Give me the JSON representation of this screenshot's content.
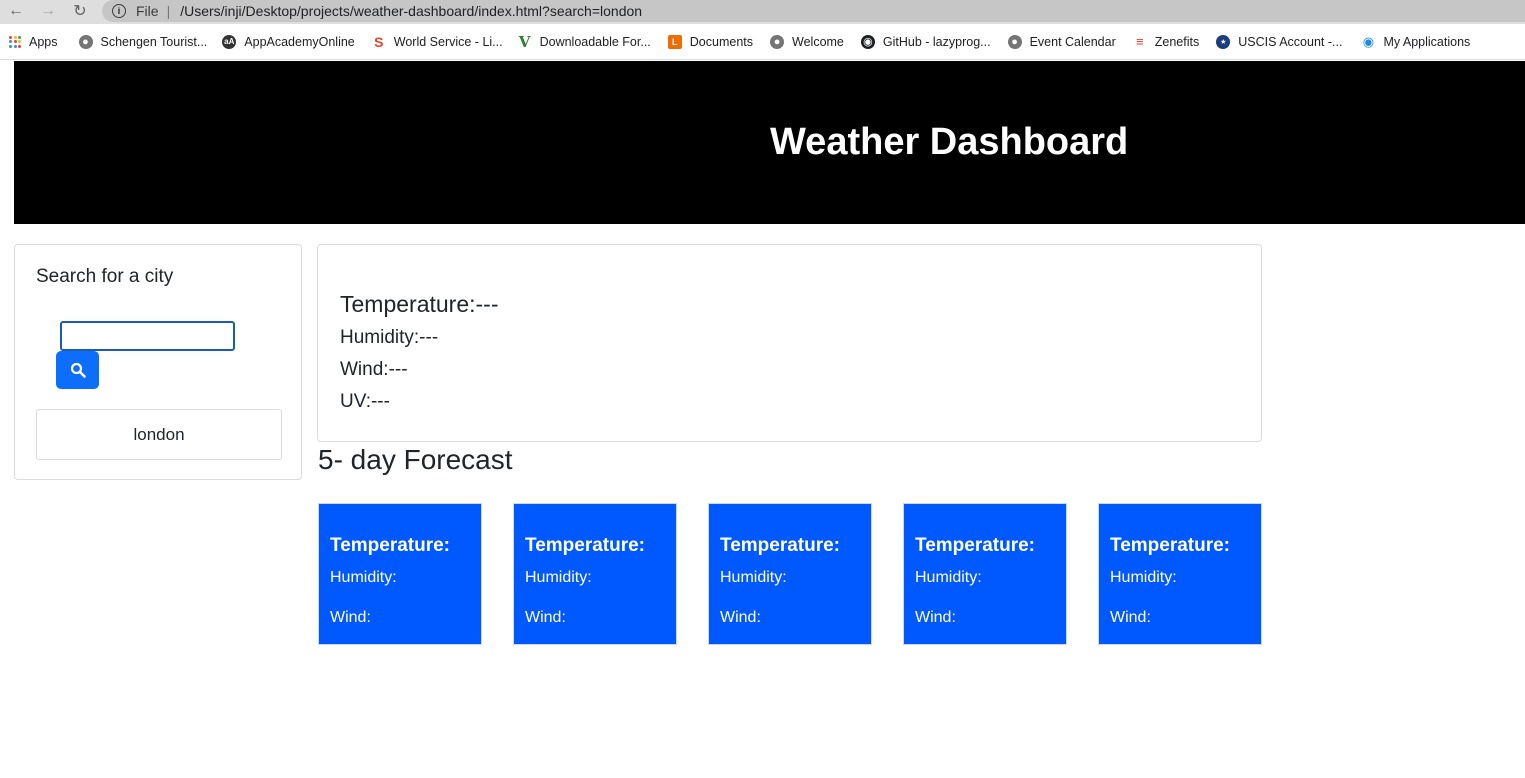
{
  "browser": {
    "scheme": "File",
    "url": "/Users/inji/Desktop/projects/weather-dashboard/index.html?search=london",
    "bookmarks": [
      {
        "label": "Apps",
        "icon": "apps-grid-icon"
      },
      {
        "label": "Schengen Tourist...",
        "icon": "globe-icon"
      },
      {
        "label": "AppAcademyOnline",
        "icon": "appacademy-icon"
      },
      {
        "label": "World Service - Li...",
        "icon": "s-logo-icon"
      },
      {
        "label": "Downloadable For...",
        "icon": "v-logo-icon"
      },
      {
        "label": "Documents",
        "icon": "documents-icon"
      },
      {
        "label": "Welcome",
        "icon": "globe-icon"
      },
      {
        "label": "GitHub - lazyprog...",
        "icon": "github-icon"
      },
      {
        "label": "Event Calendar",
        "icon": "globe-icon"
      },
      {
        "label": "Zenefits",
        "icon": "zenefits-icon"
      },
      {
        "label": "USCIS Account -...",
        "icon": "uscis-seal-icon"
      },
      {
        "label": "My Applications",
        "icon": "lightbulb-icon"
      }
    ]
  },
  "header": {
    "title": "Weather Dashboard"
  },
  "search": {
    "title": "Search for a city",
    "input_value": "",
    "history": [
      "london"
    ]
  },
  "current": {
    "temperature": "Temperature:---",
    "humidity": "Humidity:---",
    "wind": "Wind:---",
    "uv": "UV:---"
  },
  "forecast": {
    "title": "5- day Forecast",
    "days": [
      {
        "temperature": "Temperature:",
        "humidity": "Humidity:",
        "wind": "Wind:"
      },
      {
        "temperature": "Temperature:",
        "humidity": "Humidity:",
        "wind": "Wind:"
      },
      {
        "temperature": "Temperature:",
        "humidity": "Humidity:",
        "wind": "Wind:"
      },
      {
        "temperature": "Temperature:",
        "humidity": "Humidity:",
        "wind": "Wind:"
      },
      {
        "temperature": "Temperature:",
        "humidity": "Humidity:",
        "wind": "Wind:"
      }
    ]
  },
  "colors": {
    "header_bg": "#000000",
    "accent": "#0d6efd",
    "forecast_card_bg": "#0059ff"
  }
}
